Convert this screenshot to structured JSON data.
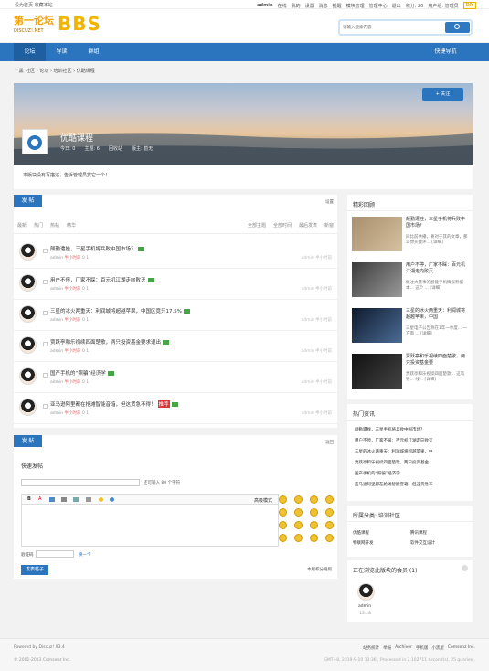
{
  "topbar": {
    "left": "设为首页  收藏本站",
    "user": "admin",
    "links": [
      "在线",
      "我的",
      "设置",
      "消息",
      "提醒",
      "模块管理",
      "管理中心",
      "退出",
      "积分: 20",
      "用户组: 管理员"
    ],
    "diy_label": "DIY"
  },
  "header": {
    "logo_text": "第一论坛",
    "logo_sub": "DISCUZ!.NET",
    "logo_bbs": "BBS",
    "search_placeholder": "请输入搜索内容"
  },
  "nav": {
    "items": [
      "论坛",
      "导读",
      "群组"
    ],
    "quick": "快捷导航"
  },
  "breadcrumb": "“黑”社区 › 论坛 › 培训社区 › 优酷课程",
  "forum": {
    "title": "优酷课程",
    "today": "今日: 0",
    "theme": "主题: 6",
    "topic_count": "回收站",
    "admin_label": "版主: 暂无",
    "follow": "+ 关注",
    "announcement": "本版块没有写描述，告诉管理员赏它一个！"
  },
  "main": {
    "post_button": "发 帖",
    "newest_label": "最新",
    "hot_label": "热门",
    "top_label": "热帖",
    "digest_label": "精华",
    "all_label": "全部主题",
    "time_label": "全部时间",
    "sort_label": "最后发表",
    "new_label": "新窗",
    "list_mode": "设置",
    "threads": [
      {
        "title": "颠勤遭挫，三星手机将兵败中国市场？",
        "author": "admin",
        "time": "半小时前",
        "views": "0",
        "replies": "1",
        "right_author": "admin",
        "right_time": "半小时前"
      },
      {
        "title": "用户不停，厂家不睬：百元机江湖走向败灭",
        "author": "admin",
        "time": "半小时前",
        "views": "0",
        "replies": "1",
        "right_author": "admin",
        "right_time": "半小时前"
      },
      {
        "title": "三星的冰火两重天：利润城将超越苹果，中国区竟只17.5%",
        "author": "admin",
        "time": "半小时前",
        "views": "0",
        "replies": "1",
        "right_author": "admin",
        "right_time": "半小时前"
      },
      {
        "title": "贾跃亭和乐视续四面楚歌，两只投资基金要求退出",
        "author": "admin",
        "time": "半小时前",
        "views": "0",
        "replies": "1",
        "right_author": "admin",
        "right_time": "半小时前"
      },
      {
        "title": "国产手机的“照骗”经济学",
        "author": "admin",
        "time": "半小时前",
        "views": "0",
        "replies": "1",
        "right_author": "admin",
        "right_time": "半小时前"
      },
      {
        "title": "亚马逊阿里都在抢滩智能音箱，但这货急不得！",
        "author": "admin",
        "time": "半小时前",
        "views": "0",
        "replies": "1",
        "right_author": "admin",
        "right_time": "半小时前",
        "tag": "推荐"
      }
    ]
  },
  "post": {
    "button": "发 帖",
    "set": "返回",
    "heading": "快速发帖",
    "hint": "还可输入 80 个字符",
    "advanced": "高级模式",
    "captcha_label": "验证码",
    "captcha_refresh": "换一个",
    "submit": "发表帖子",
    "credits": "本版积分规则"
  },
  "sidebar": {
    "featured_title": "精彩回顾",
    "items": [
      {
        "title": "颠勤遭挫，三星手机将兵败中国市场？",
        "desc": "同比前季播，要对于其的文章，那么你买我评... [详细]"
      },
      {
        "title": "用户不停，厂家不睬：百元机江湖走向败灭",
        "desc": "做过大量事的智能手机情报称据本... 这个 ... [详细]"
      },
      {
        "title": "三星的冰火两重天：利润城将超越苹果，中国",
        "desc": "三星电子公告称在1年一季度... 一方面 ... [详细]"
      },
      {
        "title": "贾跃亭和乐视续四面楚歌，两只投资基金要",
        "desc": "贾跃亭和乐视续四面楚歌... 这笔钱... 线... [详细]"
      }
    ],
    "hot_title": "热门资讯",
    "hot_items": [
      "颠勤遭挫，三星手机将兵败中国市场？",
      "用户不停，厂家不睬：百元机江湖走向败灭",
      "三星的冰火两重天：利润城将超越苹果，中",
      "贾跃亭和乐视续四面楚歌，两只投资基金",
      "国产手机的“照骗”经济学",
      "亚马逊阿里都在抢滩智能音箱，但这货急不"
    ],
    "category_title": "所属分类: 培训社区",
    "categories": [
      "优酷课程",
      "腾讯课程",
      "物联网开发",
      "软件交互设计"
    ],
    "visitors_title": "正在浏览此版块的会员 (1)",
    "visitor_name": "admin",
    "visitor_time": "13:28"
  },
  "footer": {
    "powered": "Powered by Discuz! X3.4",
    "copyright": "© 2001-2013 Comsenz Inc.",
    "links": [
      "站务统计",
      "举报",
      "Archiver",
      "手机版",
      "小黑屋",
      "Comsenz Inc."
    ],
    "debug": "GMT+8, 2019-9-10 13:36 , Processed in 2.102711 second(s), 25 queries ."
  }
}
